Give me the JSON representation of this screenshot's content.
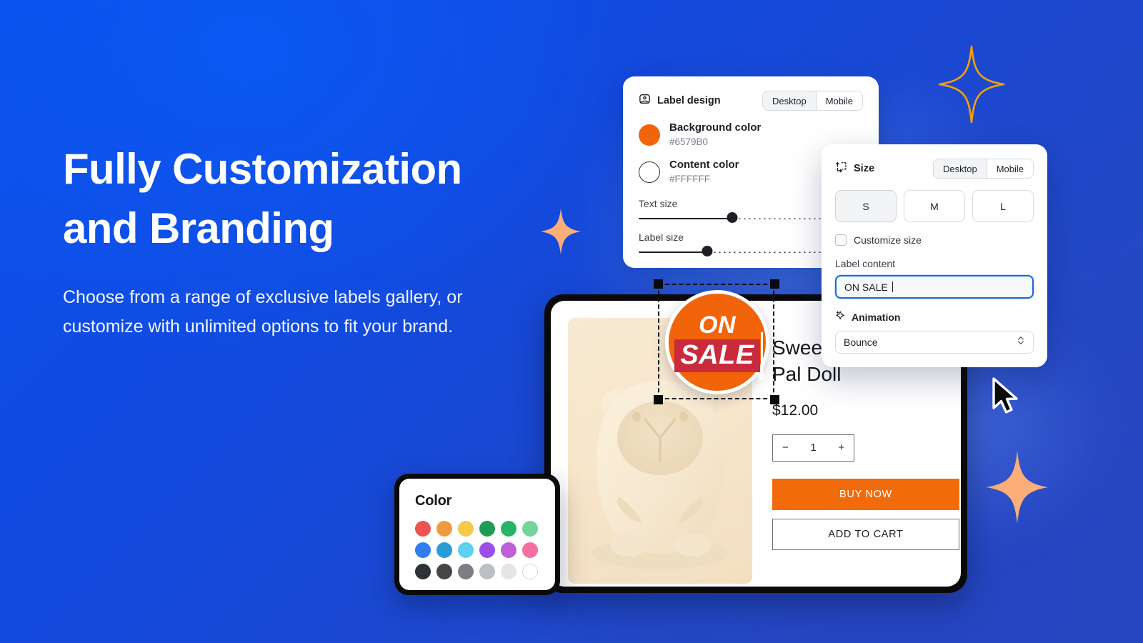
{
  "theme": {
    "bg_blue_top": "#0B52EE",
    "bg_blue_bottom": "#2A46BB",
    "accent_orange": "#F2640A",
    "sparkle_outline": "#F2A007",
    "sparkle_fill": "#FBAE78",
    "focus_blue": "#1A6AE0"
  },
  "hero": {
    "headline_line1": "Fully Customization",
    "headline_line2": "and Branding",
    "subcopy": "Choose from a range of exclusive labels gallery, or customize with unlimited options to fit your brand."
  },
  "label_design_panel": {
    "icon": "image-icon",
    "title": "Label design",
    "device_toggle": {
      "options": [
        "Desktop",
        "Mobile"
      ],
      "selected": "Desktop"
    },
    "background_color": {
      "label": "Background color",
      "hex": "#6579B0",
      "swatch": "#F2640A"
    },
    "content_color": {
      "label": "Content color",
      "hex": "#FFFFFF",
      "swatch": "#FFFFFF"
    },
    "text_size": {
      "label": "Text size",
      "percent": 48
    },
    "label_size": {
      "label": "Label size",
      "percent": 36
    }
  },
  "size_panel": {
    "icon": "resize-icon",
    "title": "Size",
    "device_toggle": {
      "options": [
        "Desktop",
        "Mobile"
      ],
      "selected": "Desktop"
    },
    "sizes": {
      "options": [
        "S",
        "M",
        "L"
      ],
      "selected": "S"
    },
    "customize_size": {
      "label": "Customize size",
      "checked": false
    },
    "label_content": {
      "label": "Label content",
      "value": "ON SALE"
    },
    "animation": {
      "icon": "sparkle-icon",
      "title": "Animation",
      "value": "Bounce"
    }
  },
  "badge": {
    "line1": "ON",
    "line2": "SALE"
  },
  "product": {
    "name_line1": "Swee",
    "name_line2": "Pal Doll",
    "price": "$12.00",
    "quantity": "1",
    "minus": "−",
    "plus": "+",
    "buy_now": "BUY NOW",
    "add_to_cart": "ADD TO CART"
  },
  "color_panel": {
    "title": "Color",
    "swatches": [
      "#EC5252",
      "#EF9A3C",
      "#F2CA47",
      "#1E9C56",
      "#26B563",
      "#74D49B",
      "#2E7EEF",
      "#2A9BD4",
      "#5BD0F0",
      "#9B4FE8",
      "#BE5FD8",
      "#F56FA2",
      "#2F3237",
      "#444649",
      "#7B7E83",
      "#BCBFC3",
      "#E3E5E8",
      "#FFFFFF"
    ]
  }
}
